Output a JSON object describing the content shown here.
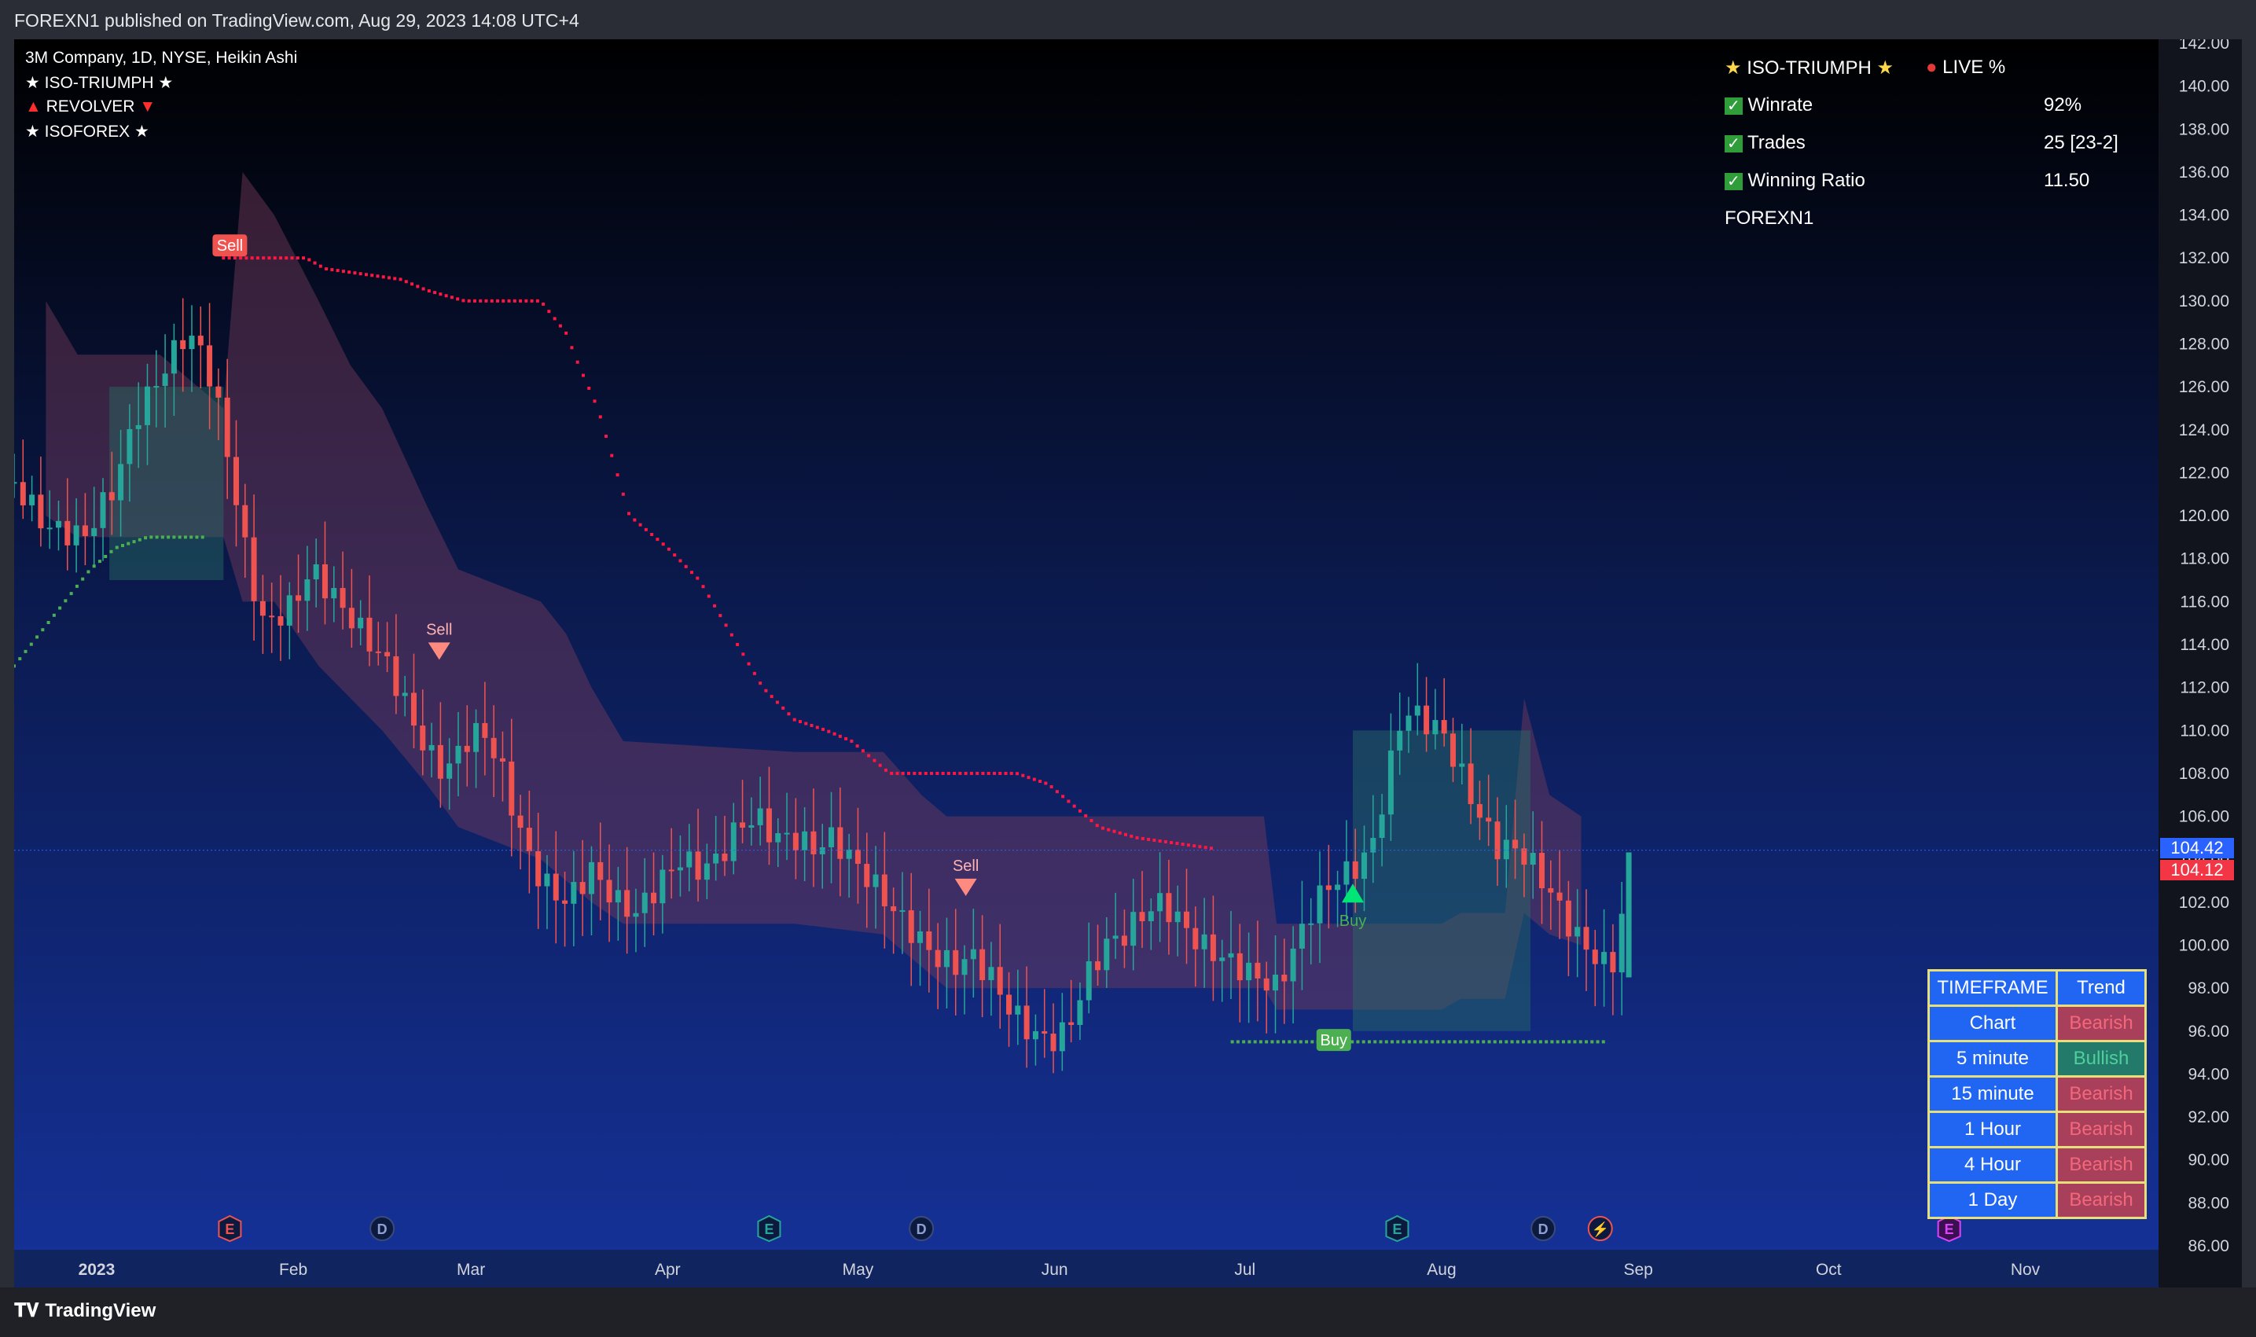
{
  "header": {
    "published_text": "FOREXN1 published on TradingView.com, Aug 29, 2023 14:08 UTC+4"
  },
  "legend": {
    "symbol_line": "3M Company, 1D, NYSE, Heikin Ashi",
    "indicators": [
      {
        "icon": "star-icon",
        "label": "ISO-TRIUMPH",
        "trail_icon": "star-icon"
      },
      {
        "icon": "triangle-up-red-icon",
        "label": "REVOLVER",
        "trail_icon": "triangle-down-red-icon"
      },
      {
        "icon": "star-icon",
        "label": "ISOFOREX",
        "trail_icon": "star-icon"
      }
    ]
  },
  "stats_panel": {
    "title": "ISO-TRIUMPH",
    "live_label": "LIVE %",
    "rows": [
      {
        "label": "Winrate",
        "value": "92%"
      },
      {
        "label": "Trades",
        "value": "25 [23-2]"
      },
      {
        "label": "Winning Ratio",
        "value": "11.50"
      }
    ],
    "author": "FOREXN1"
  },
  "timeframe_table": {
    "headers": [
      "TIMEFRAME",
      "Trend"
    ],
    "rows": [
      {
        "timeframe": "Chart",
        "trend": "Bearish"
      },
      {
        "timeframe": "5 minute",
        "trend": "Bullish"
      },
      {
        "timeframe": "15 minute",
        "trend": "Bearish"
      },
      {
        "timeframe": "1 Hour",
        "trend": "Bearish"
      },
      {
        "timeframe": "4 Hour",
        "trend": "Bearish"
      },
      {
        "timeframe": "1 Day",
        "trend": "Bearish"
      }
    ]
  },
  "price_tags": {
    "last_price": "104.42",
    "close_price": "104.12"
  },
  "footer": {
    "brand": "TradingView"
  },
  "colors": {
    "bull": "#26a69a",
    "bear": "#ef5350",
    "sell_dots": "#ff1744",
    "buy_dots": "#4caf50",
    "cloud_bear": "rgba(120,60,90,0.45)",
    "cloud_bull": "rgba(40,110,100,0.45)",
    "bg_top": "#000000",
    "bg_bottom": "#132f88"
  },
  "chart_data": {
    "type": "candlestick",
    "title": "3M Company, 1D, NYSE, Heikin Ashi",
    "ylim": [
      86,
      142
    ],
    "y_ticks": [
      "142.00",
      "140.00",
      "138.00",
      "136.00",
      "134.00",
      "132.00",
      "130.00",
      "128.00",
      "126.00",
      "124.00",
      "122.00",
      "120.00",
      "118.00",
      "116.00",
      "114.00",
      "112.00",
      "110.00",
      "108.00",
      "106.00",
      "104.00",
      "102.00",
      "100.00",
      "98.00",
      "96.00",
      "94.00",
      "92.00",
      "90.00",
      "88.00",
      "86.00"
    ],
    "x_ticks": [
      "2023",
      "Feb",
      "Mar",
      "Apr",
      "May",
      "Jun",
      "Jul",
      "Aug",
      "Sep",
      "Oct",
      "Nov"
    ],
    "x_tick_days": [
      0,
      31,
      59,
      90,
      120,
      151,
      181,
      212,
      243,
      273,
      304
    ],
    "x_range_days": [
      -13,
      325
    ],
    "close_anchors": [
      [
        -13,
        121.5
      ],
      [
        -8,
        119.5
      ],
      [
        -2,
        119.0
      ],
      [
        3,
        121.5
      ],
      [
        6,
        124.5
      ],
      [
        10,
        126.5
      ],
      [
        14,
        128.5
      ],
      [
        17,
        127.5
      ],
      [
        20,
        124.0
      ],
      [
        23,
        119.0
      ],
      [
        26,
        115.0
      ],
      [
        30,
        115.5
      ],
      [
        34,
        117.5
      ],
      [
        38,
        116.0
      ],
      [
        42,
        114.5
      ],
      [
        46,
        113.0
      ],
      [
        49,
        111.0
      ],
      [
        52,
        109.0
      ],
      [
        55,
        108.0
      ],
      [
        58,
        109.5
      ],
      [
        61,
        110.0
      ],
      [
        64,
        108.0
      ],
      [
        67,
        105.0
      ],
      [
        70,
        103.0
      ],
      [
        74,
        102.0
      ],
      [
        78,
        103.5
      ],
      [
        82,
        102.0
      ],
      [
        85,
        101.5
      ],
      [
        89,
        103.0
      ],
      [
        92,
        104.0
      ],
      [
        95,
        103.5
      ],
      [
        98,
        104.0
      ],
      [
        101,
        105.5
      ],
      [
        104,
        106.0
      ],
      [
        107,
        105.0
      ],
      [
        110,
        105.0
      ],
      [
        113,
        104.5
      ],
      [
        116,
        105.0
      ],
      [
        119,
        104.0
      ],
      [
        122,
        103.0
      ],
      [
        126,
        101.5
      ],
      [
        129,
        100.5
      ],
      [
        132,
        99.5
      ],
      [
        135,
        99.0
      ],
      [
        138,
        99.5
      ],
      [
        141,
        98.5
      ],
      [
        144,
        97.0
      ],
      [
        147,
        96.0
      ],
      [
        150,
        95.5
      ],
      [
        153,
        96.0
      ],
      [
        156,
        98.5
      ],
      [
        159,
        100.0
      ],
      [
        162,
        100.5
      ],
      [
        165,
        101.5
      ],
      [
        168,
        102.0
      ],
      [
        171,
        101.0
      ],
      [
        174,
        100.0
      ],
      [
        177,
        99.5
      ],
      [
        180,
        99.0
      ],
      [
        183,
        98.5
      ],
      [
        186,
        98.0
      ],
      [
        189,
        100.0
      ],
      [
        192,
        102.0
      ],
      [
        195,
        103.0
      ],
      [
        198,
        103.5
      ],
      [
        201,
        104.5
      ],
      [
        204,
        108.5
      ],
      [
        206,
        111.0
      ],
      [
        209,
        110.5
      ],
      [
        212,
        110.0
      ],
      [
        215,
        108.0
      ],
      [
        218,
        106.0
      ],
      [
        221,
        104.5
      ],
      [
        224,
        104.5
      ],
      [
        227,
        103.5
      ],
      [
        230,
        102.0
      ],
      [
        233,
        100.5
      ],
      [
        236,
        99.5
      ],
      [
        238,
        99.0
      ],
      [
        240,
        99.5
      ],
      [
        241,
        104.0
      ]
    ],
    "last_close": 104.12,
    "last_price": 104.42,
    "sell_stop_dots": [
      [
        20,
        132
      ],
      [
        33,
        132
      ],
      [
        36,
        131.5
      ],
      [
        48,
        131.0
      ],
      [
        52,
        130.5
      ],
      [
        58,
        130.0
      ],
      [
        70,
        130.0
      ],
      [
        74,
        128.5
      ],
      [
        76,
        127.0
      ],
      [
        79,
        125.0
      ],
      [
        81,
        123.0
      ],
      [
        84,
        120.0
      ],
      [
        90,
        118.5
      ],
      [
        95,
        117.0
      ],
      [
        100,
        114.5
      ],
      [
        105,
        112.0
      ],
      [
        110,
        110.5
      ],
      [
        115,
        110.0
      ],
      [
        119,
        109.5
      ],
      [
        125,
        108.0
      ],
      [
        145,
        108.0
      ],
      [
        150,
        107.5
      ],
      [
        154,
        106.5
      ],
      [
        158,
        105.5
      ],
      [
        164,
        105.0
      ],
      [
        176,
        104.5
      ]
    ],
    "buy_stop_dots": [
      [
        -13,
        113.0
      ],
      [
        -9,
        114.5
      ],
      [
        -5,
        116.0
      ],
      [
        -1,
        117.5
      ],
      [
        3,
        118.5
      ],
      [
        8,
        119.0
      ],
      [
        17,
        119.0
      ]
    ],
    "buy_stop_dots_2": [
      [
        179,
        95.5
      ],
      [
        238,
        95.5
      ]
    ],
    "cloud_bear_upper": [
      [
        -8,
        130
      ],
      [
        -3,
        127.5
      ],
      [
        10,
        127.5
      ],
      [
        20,
        125
      ],
      [
        23,
        136
      ],
      [
        28,
        134
      ],
      [
        35,
        130
      ],
      [
        40,
        127.0
      ],
      [
        45,
        125.0
      ],
      [
        52,
        120.5
      ],
      [
        57,
        117.5
      ],
      [
        70,
        116.0
      ],
      [
        74,
        114.5
      ],
      [
        78,
        112.0
      ],
      [
        83,
        109.5
      ],
      [
        110,
        109.0
      ],
      [
        124,
        109.0
      ],
      [
        130,
        107.0
      ],
      [
        134,
        106.0
      ],
      [
        184,
        106.0
      ],
      [
        186,
        101.0
      ],
      [
        198,
        101.0
      ],
      [
        212,
        101.0
      ],
      [
        215,
        101.5
      ],
      [
        222,
        101.5
      ],
      [
        225,
        111.5
      ],
      [
        229,
        107.0
      ],
      [
        234,
        106.0
      ]
    ],
    "cloud_bear_lower": [
      [
        -8,
        120
      ],
      [
        -3,
        119
      ],
      [
        10,
        119
      ],
      [
        20,
        119
      ],
      [
        23,
        116
      ],
      [
        28,
        116
      ],
      [
        35,
        113
      ],
      [
        40,
        111.5
      ],
      [
        45,
        110.0
      ],
      [
        52,
        107.5
      ],
      [
        57,
        105.5
      ],
      [
        70,
        104.0
      ],
      [
        74,
        103.0
      ],
      [
        78,
        102.0
      ],
      [
        83,
        101.0
      ],
      [
        110,
        101.0
      ],
      [
        124,
        100.5
      ],
      [
        130,
        99.0
      ],
      [
        134,
        98.0
      ],
      [
        184,
        98.0
      ],
      [
        186,
        97.0
      ],
      [
        198,
        97.0
      ],
      [
        212,
        97.0
      ],
      [
        215,
        97.5
      ],
      [
        222,
        97.5
      ],
      [
        225,
        101.5
      ],
      [
        229,
        100.5
      ],
      [
        234,
        100.0
      ]
    ],
    "signals": [
      {
        "label": "Sell",
        "type": "sell",
        "day": 21,
        "price": 132.0,
        "style": "box"
      },
      {
        "label": "Sell",
        "type": "sell",
        "day": 54,
        "price": 113.0,
        "style": "triangle"
      },
      {
        "label": "Sell",
        "type": "sell",
        "day": 137,
        "price": 102.0,
        "style": "triangle"
      },
      {
        "label": "Buy",
        "type": "buy",
        "day": 198,
        "price": 102.5,
        "style": "triangle"
      },
      {
        "label": "Buy",
        "type": "buy",
        "day": 195,
        "price": 95.0,
        "style": "box"
      }
    ],
    "events": [
      {
        "day": 21,
        "glyph": "E",
        "kind": "earnings-bear"
      },
      {
        "day": 45,
        "glyph": "D",
        "kind": "dividend"
      },
      {
        "day": 106,
        "glyph": "E",
        "kind": "earnings-bull"
      },
      {
        "day": 130,
        "glyph": "D",
        "kind": "dividend"
      },
      {
        "day": 205,
        "glyph": "E",
        "kind": "earnings-bull"
      },
      {
        "day": 228,
        "glyph": "D",
        "kind": "dividend"
      },
      {
        "day": 237,
        "glyph": "⚡",
        "kind": "split"
      },
      {
        "day": 292,
        "glyph": "E",
        "kind": "earnings-future"
      }
    ]
  }
}
